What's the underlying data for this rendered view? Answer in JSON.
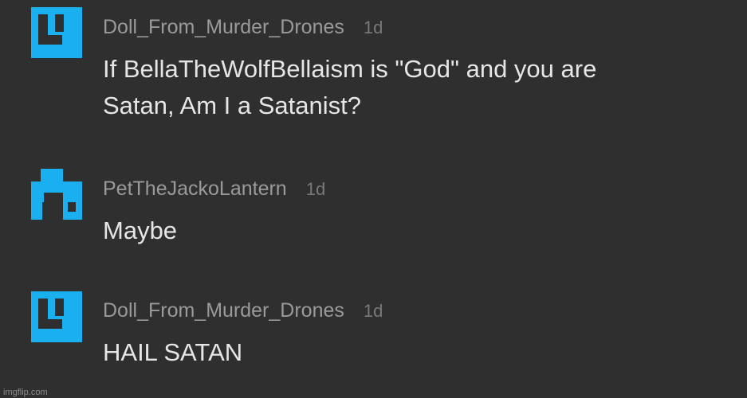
{
  "comments": [
    {
      "username": "Doll_From_Murder_Drones",
      "time": "1d",
      "text_lines": [
        "If BellaTheWolfBellaism is \"God\" and you are",
        "Satan, Am I a Satanist?"
      ],
      "avatar_icon": "pixel-glyph-4-icon"
    },
    {
      "username": "PetTheJackoLantern",
      "time": "1d",
      "text_lines": [
        "Maybe"
      ],
      "avatar_icon": "pixel-glyph-7-icon"
    },
    {
      "username": "Doll_From_Murder_Drones",
      "time": "1d",
      "text_lines": [
        "HAIL SATAN"
      ],
      "avatar_icon": "pixel-glyph-4-icon"
    }
  ],
  "watermark": "imgflip.com",
  "colors": {
    "background": "#2f2f2f",
    "avatar": "#1ab0f0",
    "username": "#9a9a9a",
    "timestamp": "#7a7a7a",
    "text": "#e6e6e6"
  }
}
